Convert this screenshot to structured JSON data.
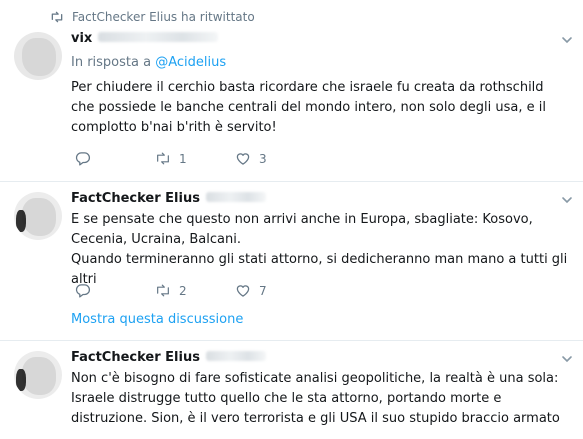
{
  "tweets": [
    {
      "retweet_label": "FactChecker Elius ha ritwittato",
      "name": "vix",
      "handle": "",
      "reply_prefix": "In risposta a",
      "reply_to": "@Acidelius",
      "text_lines": [
        "Per chiudere il cerchio basta ricordare che israele fu creata da rothschild che possiede le banche centrali del mondo intero, non solo degli usa, e il complotto b'nai b'rith è servito!"
      ],
      "retweets": "1",
      "likes": "3"
    },
    {
      "name": "FactChecker Elius",
      "handle": "",
      "text_lines": [
        "E se pensate che questo non arrivi anche in Europa, sbagliate: Kosovo, Cecenia, Ucraina, Balcani.",
        "Quando termineranno gli stati attorno, si dedicheranno man mano a tutti gli altri"
      ],
      "retweets": "2",
      "likes": "7",
      "show_thread": "Mostra questa discussione"
    },
    {
      "name": "FactChecker Elius",
      "handle": "",
      "text_lines": [
        "Non c'è bisogno di fare sofisticate analisi geopolitiche, la realtà è una sola: Israele distrugge tutto quello che le sta attorno, portando morte e distruzione. Sion, è il vero terrorista e gli USA il suo stupido braccio armato"
      ]
    }
  ],
  "icons": {
    "retweet": "retweet-icon",
    "reply": "reply-icon",
    "like": "heart-icon",
    "chevron": "chevron-down-icon"
  },
  "colors": {
    "link": "#1da1f2",
    "secondary_text": "#657786",
    "divider": "#e6ecf0"
  }
}
